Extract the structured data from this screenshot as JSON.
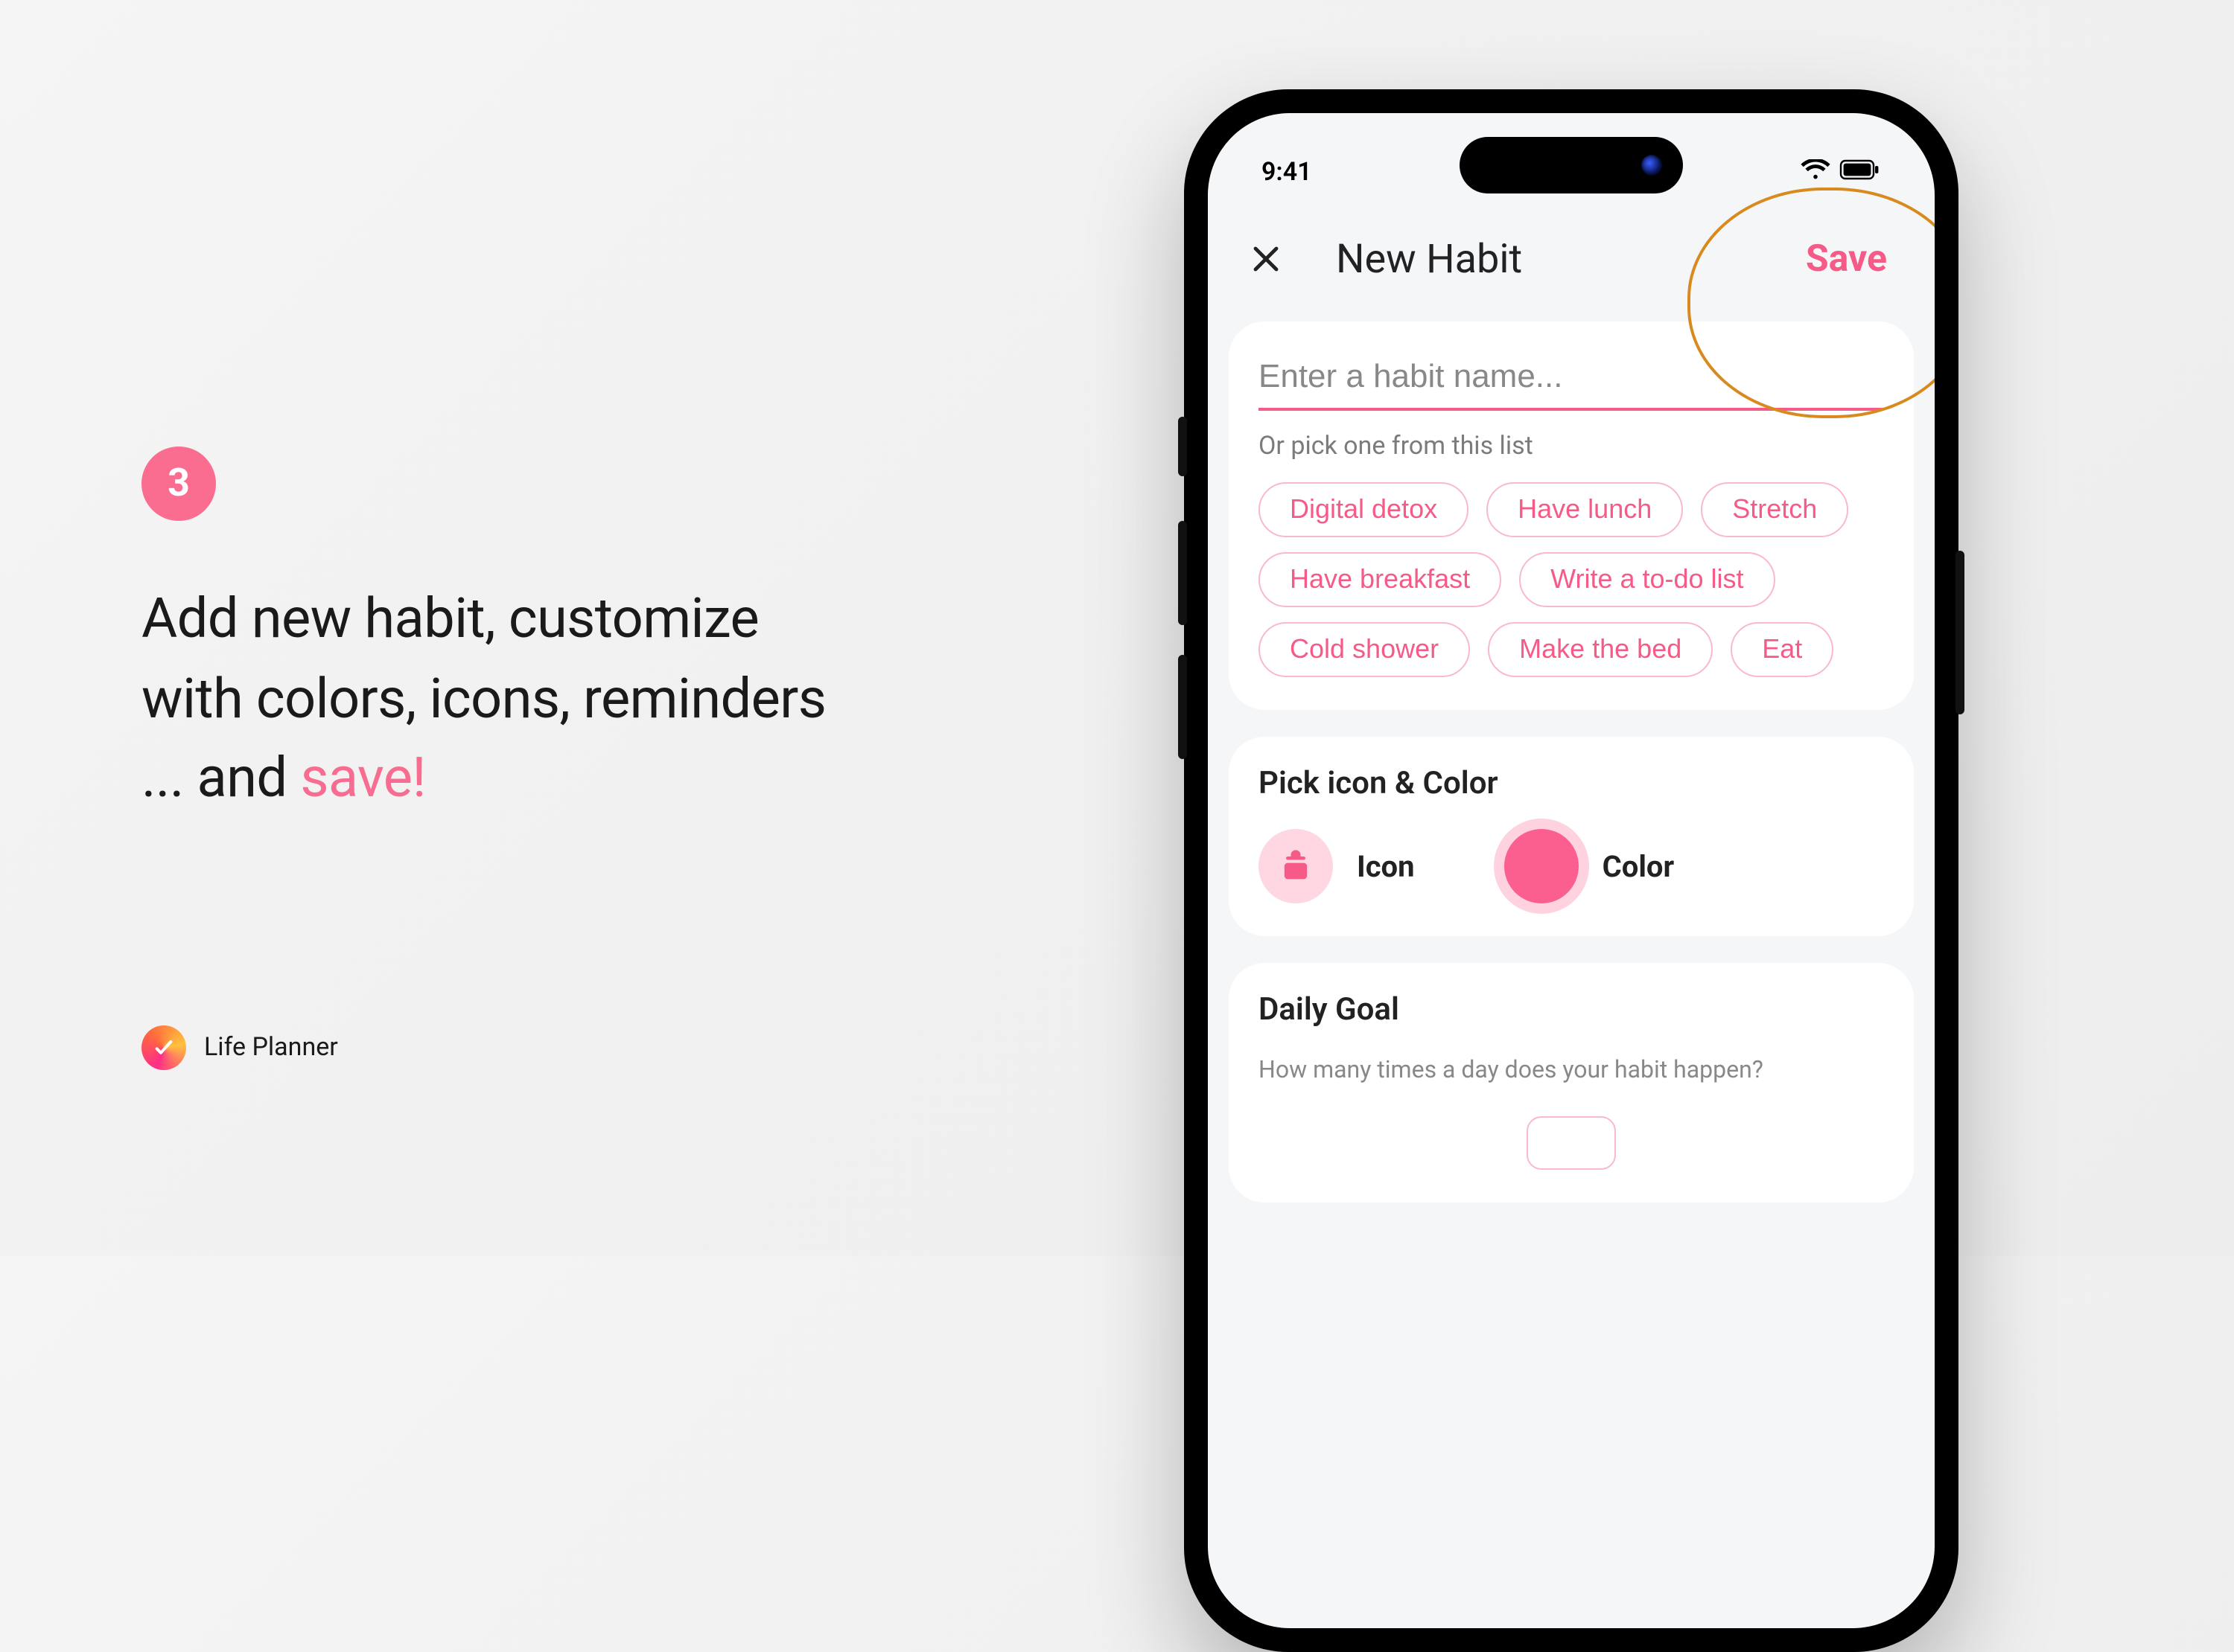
{
  "step": {
    "number": "3",
    "line1": "Add new habit, customize",
    "line2": "with colors, icons, reminders",
    "line3_prefix": "... and ",
    "line3_accent": "save!"
  },
  "brand": {
    "name": "Life Planner"
  },
  "statusbar": {
    "time": "9:41"
  },
  "topbar": {
    "title": "New Habit",
    "save": "Save"
  },
  "habit": {
    "placeholder": "Enter a habit name...",
    "hint": "Or pick one from this list",
    "suggestions": [
      "Digital detox",
      "Have lunch",
      "Stretch",
      "Have breakfast",
      "Write a to-do list",
      "Cold shower",
      "Make the bed",
      "Eat"
    ]
  },
  "picker": {
    "title": "Pick icon & Color",
    "icon_label": "Icon",
    "color_label": "Color"
  },
  "goal": {
    "title": "Daily Goal",
    "subtitle": "How many times a day does your habit happen?"
  },
  "colors": {
    "accent": "#f65a87"
  }
}
